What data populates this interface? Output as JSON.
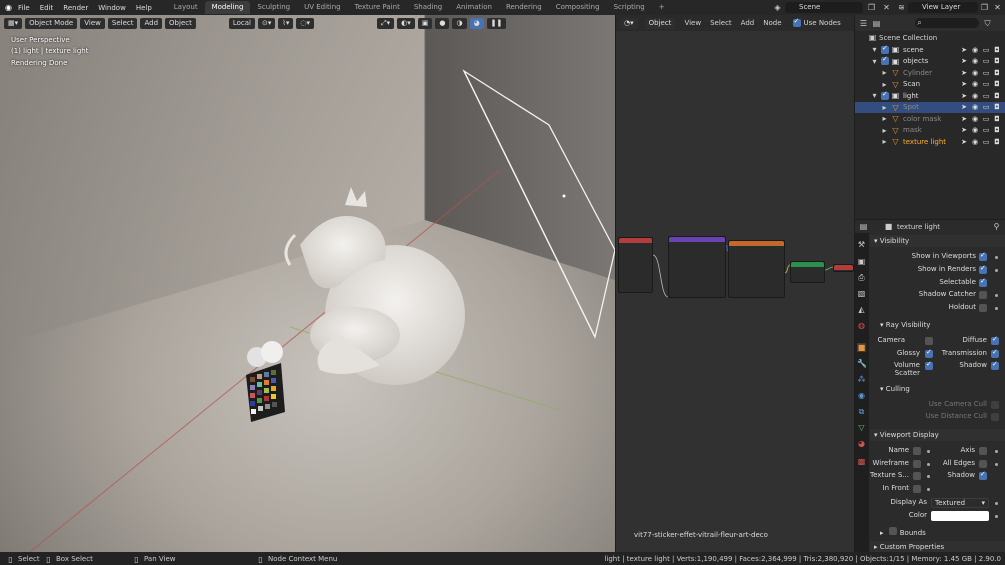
{
  "menus": [
    "File",
    "Edit",
    "Render",
    "Window",
    "Help"
  ],
  "workspace_tabs": [
    "Layout",
    "Modeling",
    "Sculpting",
    "UV Editing",
    "Texture Paint",
    "Shading",
    "Animation",
    "Rendering",
    "Compositing",
    "Scripting"
  ],
  "active_tab": "Modeling",
  "scene_name": "Scene",
  "view_layer": "View Layer",
  "viewport": {
    "mode": "Object Mode",
    "menu": [
      "View",
      "Select",
      "Add",
      "Object"
    ],
    "transform": "Local",
    "overlay_lines": [
      "User Perspective",
      "(1) light | texture light",
      "Rendering Done"
    ]
  },
  "node_editor": {
    "type": "Object",
    "menu": [
      "View",
      "Select",
      "Add",
      "Node"
    ],
    "use_nodes": "Use Nodes",
    "image_name": "vit77-sticker-effet-vitrail-fleur-art-deco"
  },
  "outliner": {
    "collection": "Scene Collection",
    "items": [
      {
        "name": "scene",
        "indent": 1
      },
      {
        "name": "objects",
        "indent": 1
      },
      {
        "name": "Cylinder",
        "indent": 2,
        "dim": true
      },
      {
        "name": "Scan",
        "indent": 2
      },
      {
        "name": "light",
        "indent": 1
      },
      {
        "name": "Spot",
        "indent": 2,
        "dim": true,
        "selected": true
      },
      {
        "name": "color mask",
        "indent": 2,
        "dim": true
      },
      {
        "name": "mask",
        "indent": 2,
        "dim": true
      },
      {
        "name": "texture light",
        "indent": 2,
        "active": true
      }
    ]
  },
  "properties": {
    "object_name": "texture light",
    "visibility": "Visibility",
    "show_in_viewports": "Show in Viewports",
    "show_in_renders": "Show in Renders",
    "selectable": "Selectable",
    "shadow_catcher": "Shadow Catcher",
    "holdout": "Holdout",
    "ray_visibility": "Ray Visibility",
    "camera": "Camera",
    "diffuse": "Diffuse",
    "glossy": "Glossy",
    "transmission": "Transmission",
    "volume_scatter": "Volume Scatter",
    "shadow": "Shadow",
    "culling": "Culling",
    "use_camera_cull": "Use Camera Cull",
    "use_distance_cull": "Use Distance Cull",
    "viewport_display": "Viewport Display",
    "name": "Name",
    "axis": "Axis",
    "wireframe": "Wireframe",
    "all_edges": "All Edges",
    "texture_space": "Texture S...",
    "shadow2": "Shadow",
    "in_front": "In Front",
    "display_as": "Display As",
    "display_as_value": "Textured",
    "color": "Color",
    "bounds": "Bounds",
    "custom_properties": "Custom Properties"
  },
  "statusbar": {
    "select": "Select",
    "box_select": "Box Select",
    "pan_view": "Pan View",
    "node_context": "Node Context Menu",
    "stats": "light | texture light | Verts:1,190,499 | Faces:2,364,999 | Tris:2,380,920 | Objects:1/15 | Memory: 1.45 GB | 2.90.0"
  }
}
